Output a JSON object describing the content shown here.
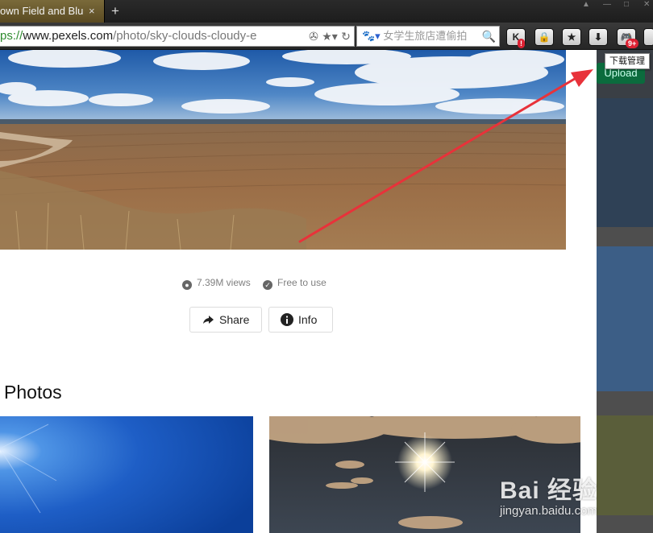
{
  "browser": {
    "tab_title": "own Field and Blu",
    "tab_close": "×",
    "new_tab": "+",
    "url_scheme": "ps://",
    "url_host": "www.pexels.com",
    "url_path": "/photo/sky-clouds-cloudy-e",
    "search_placeholder": "女学生旅店遭偷拍",
    "extensions": [
      {
        "icon": "k-icon",
        "label": "K",
        "badge": "!"
      },
      {
        "icon": "lock-icon",
        "label": "🔒"
      },
      {
        "icon": "star-icon",
        "label": "★"
      },
      {
        "icon": "download-icon",
        "label": "⬇"
      },
      {
        "icon": "gamepad-icon",
        "label": "🎮",
        "badge": "9+"
      }
    ],
    "tooltip": "下载管理"
  },
  "photo": {
    "stats": {
      "views": "7.39M views",
      "license": "Free to use"
    },
    "buttons": {
      "share": "Share",
      "info": "Info"
    }
  },
  "section": {
    "title": "r Photos"
  },
  "side": {
    "upload": "Upload"
  },
  "watermark": {
    "logo": "Bai 经验",
    "url": "jingyan.baidu.com"
  }
}
